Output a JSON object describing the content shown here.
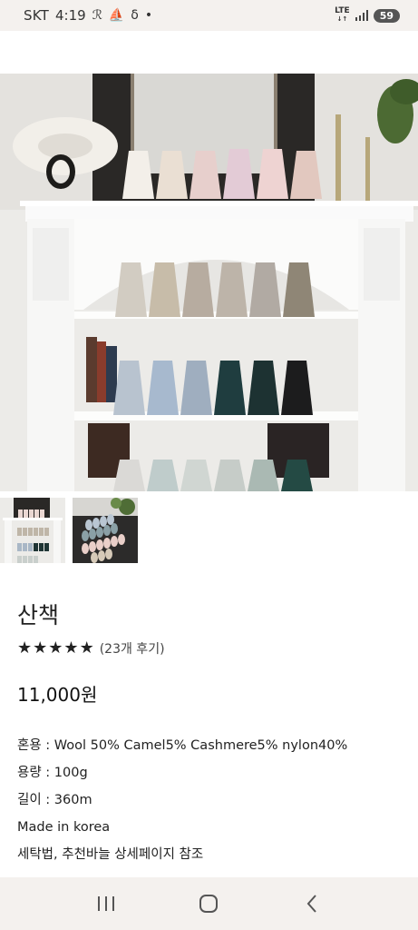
{
  "status_bar": {
    "carrier": "SKT",
    "time": "4:19",
    "network": "LTE",
    "battery": "59"
  },
  "product": {
    "name": "산책",
    "rating_stars": 5,
    "reviews": "(23개 후기)",
    "price": "11,000원",
    "specs": [
      "혼용 : Wool 50% Camel5% Cashmere5% nylon40%",
      "용량 : 100g",
      "길이 : 360m",
      "Made in korea",
      "세탁법, 추천바늘 상세페이지 참조"
    ]
  },
  "colors": {
    "status_bg": "#f4f1ee",
    "text": "#222222"
  }
}
